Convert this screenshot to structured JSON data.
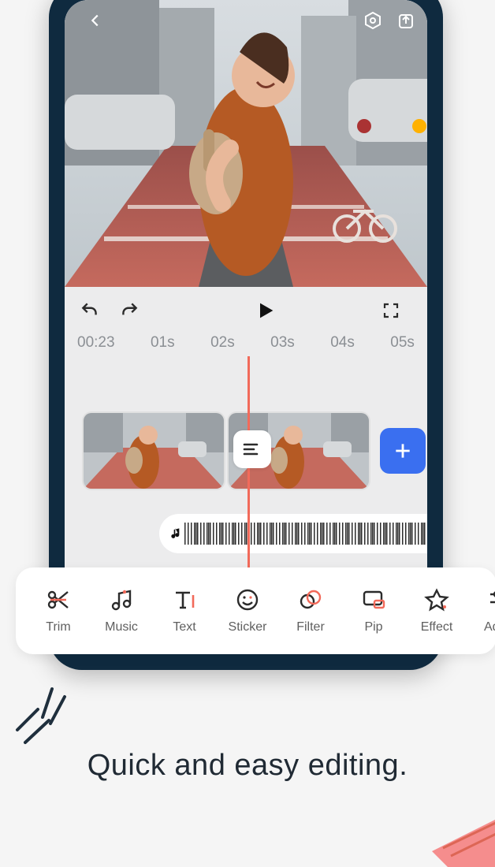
{
  "colors": {
    "accent": "#f26a5a",
    "primary_button": "#3a6ff0",
    "phone_frame": "#0f2a3f"
  },
  "preview": {
    "top_icons": [
      "back",
      "settings-hex",
      "export"
    ]
  },
  "playback": {
    "current_time": "00:23",
    "ruler": [
      "01s",
      "02s",
      "03s",
      "04s",
      "05s"
    ]
  },
  "timeline": {
    "clips_count": 2,
    "add_label": "+"
  },
  "toolbar": {
    "items": [
      {
        "icon": "scissors",
        "label": "Trim"
      },
      {
        "icon": "music-note",
        "label": "Music"
      },
      {
        "icon": "text",
        "label": "Text"
      },
      {
        "icon": "sticker-face",
        "label": "Sticker"
      },
      {
        "icon": "filter-circles",
        "label": "Filter"
      },
      {
        "icon": "pip",
        "label": "Pip"
      },
      {
        "icon": "star",
        "label": "Effect"
      },
      {
        "icon": "sliders",
        "label": "Adjus"
      }
    ]
  },
  "tagline": "Quick and easy editing."
}
